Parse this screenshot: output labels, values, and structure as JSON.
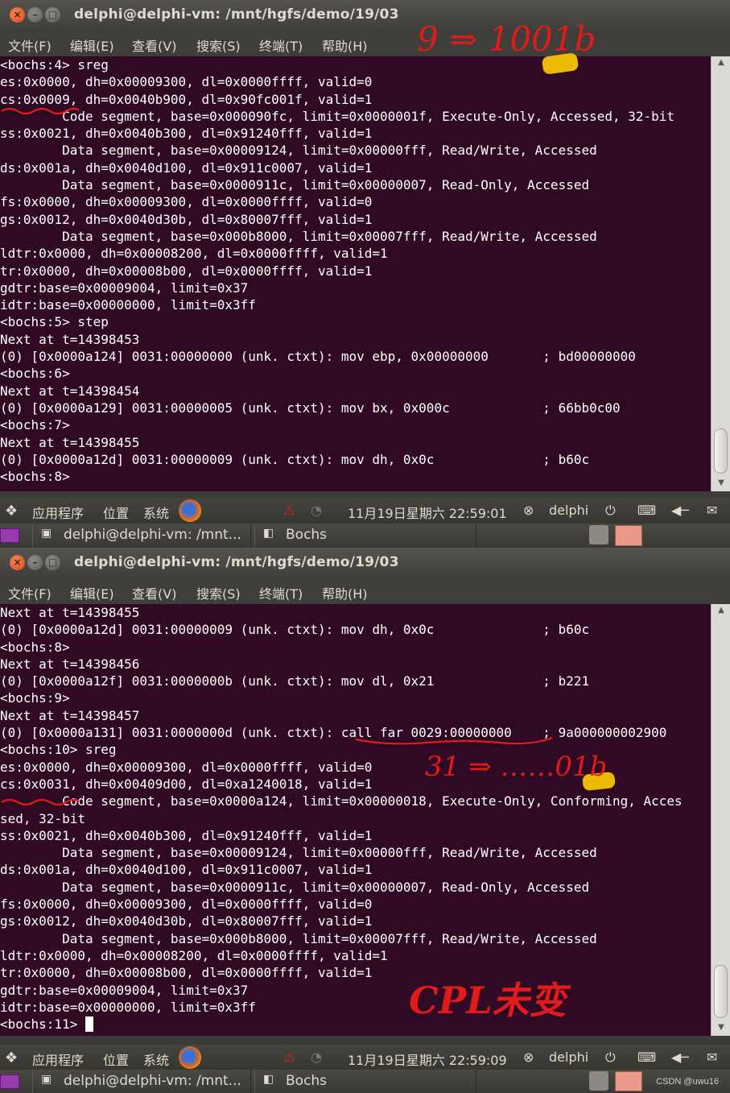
{
  "top_window": {
    "title": "delphi@delphi-vm: /mnt/hgfs/demo/19/03",
    "menu": [
      "文件(F)",
      "编辑(E)",
      "查看(V)",
      "搜索(S)",
      "终端(T)",
      "帮助(H)"
    ],
    "lines": [
      "<bochs:4> sreg",
      "es:0x0000, dh=0x00009300, dl=0x0000ffff, valid=0",
      "cs:0x0009, dh=0x0040b900, dl=0x90fc001f, valid=1",
      "        Code segment, base=0x000090fc, limit=0x0000001f, Execute-Only, Accessed, 32-bit",
      "ss:0x0021, dh=0x0040b300, dl=0x91240fff, valid=1",
      "        Data segment, base=0x00009124, limit=0x00000fff, Read/Write, Accessed",
      "ds:0x001a, dh=0x0040d100, dl=0x911c0007, valid=1",
      "        Data segment, base=0x0000911c, limit=0x00000007, Read-Only, Accessed",
      "fs:0x0000, dh=0x00009300, dl=0x0000ffff, valid=0",
      "gs:0x0012, dh=0x0040d30b, dl=0x80007fff, valid=1",
      "        Data segment, base=0x000b8000, limit=0x00007fff, Read/Write, Accessed",
      "ldtr:0x0000, dh=0x00008200, dl=0x0000ffff, valid=1",
      "tr:0x0000, dh=0x00008b00, dl=0x0000ffff, valid=1",
      "gdtr:base=0x00009004, limit=0x37",
      "idtr:base=0x00000000, limit=0x3ff",
      "<bochs:5> step",
      "Next at t=14398453",
      "(0) [0x0000a124] 0031:00000000 (unk. ctxt): mov ebp, 0x00000000       ; bd00000000",
      "<bochs:6>",
      "Next at t=14398454",
      "(0) [0x0000a129] 0031:00000005 (unk. ctxt): mov bx, 0x000c            ; 66bb0c00",
      "<bochs:7>",
      "Next at t=14398455",
      "(0) [0x0000a12d] 0031:00000009 (unk. ctxt): mov dh, 0x0c              ; b60c",
      "<bochs:8>"
    ],
    "annotation": "9 ⇒ 1001b"
  },
  "bottom_window": {
    "title": "delphi@delphi-vm: /mnt/hgfs/demo/19/03",
    "menu": [
      "文件(F)",
      "编辑(E)",
      "查看(V)",
      "搜索(S)",
      "终端(T)",
      "帮助(H)"
    ],
    "lines": [
      "Next at t=14398455",
      "(0) [0x0000a12d] 0031:00000009 (unk. ctxt): mov dh, 0x0c              ; b60c",
      "<bochs:8>",
      "Next at t=14398456",
      "(0) [0x0000a12f] 0031:0000000b (unk. ctxt): mov dl, 0x21              ; b221",
      "<bochs:9>",
      "Next at t=14398457",
      "(0) [0x0000a131] 0031:0000000d (unk. ctxt): call far 0029:00000000    ; 9a000000002900",
      "<bochs:10> sreg",
      "es:0x0000, dh=0x00009300, dl=0x0000ffff, valid=0",
      "cs:0x0031, dh=0x00409d00, dl=0xa1240018, valid=1",
      "        Code segment, base=0x0000a124, limit=0x00000018, Execute-Only, Conforming, Acces",
      "sed, 32-bit",
      "ss:0x0021, dh=0x0040b300, dl=0x91240fff, valid=1",
      "        Data segment, base=0x00009124, limit=0x00000fff, Read/Write, Accessed",
      "ds:0x001a, dh=0x0040d100, dl=0x911c0007, valid=1",
      "        Data segment, base=0x0000911c, limit=0x00000007, Read-Only, Accessed",
      "fs:0x0000, dh=0x00009300, dl=0x0000ffff, valid=0",
      "gs:0x0012, dh=0x0040d30b, dl=0x80007fff, valid=1",
      "        Data segment, base=0x000b8000, limit=0x00007fff, Read/Write, Accessed",
      "ldtr:0x0000, dh=0x00008200, dl=0x0000ffff, valid=1",
      "tr:0x0000, dh=0x00008b00, dl=0x0000ffff, valid=1",
      "gdtr:base=0x00009004, limit=0x37",
      "idtr:base=0x00000000, limit=0x3ff"
    ],
    "prompt": "<bochs:11> ",
    "annotation_31": "31 ⇒ ……01b",
    "annotation_cpl": "CPL未变"
  },
  "panel_top": {
    "menus": [
      "应用程序",
      "位置",
      "系统"
    ],
    "datetime": "11月19日星期六 22:59:01",
    "user": "delphi"
  },
  "panel_bottom": {
    "menus": [
      "应用程序",
      "位置",
      "系统"
    ],
    "datetime": "11月19日星期六 22:59:09",
    "user": "delphi"
  },
  "taskbar": {
    "terminal_label": "delphi@delphi-vm: /mnt...",
    "bochs_label": "Bochs"
  },
  "watermark": "CSDN @uwu16",
  "colors": {
    "terminal_bg": "#300a24",
    "annotation": "#e01b1b",
    "highlight": "#f5c400"
  }
}
